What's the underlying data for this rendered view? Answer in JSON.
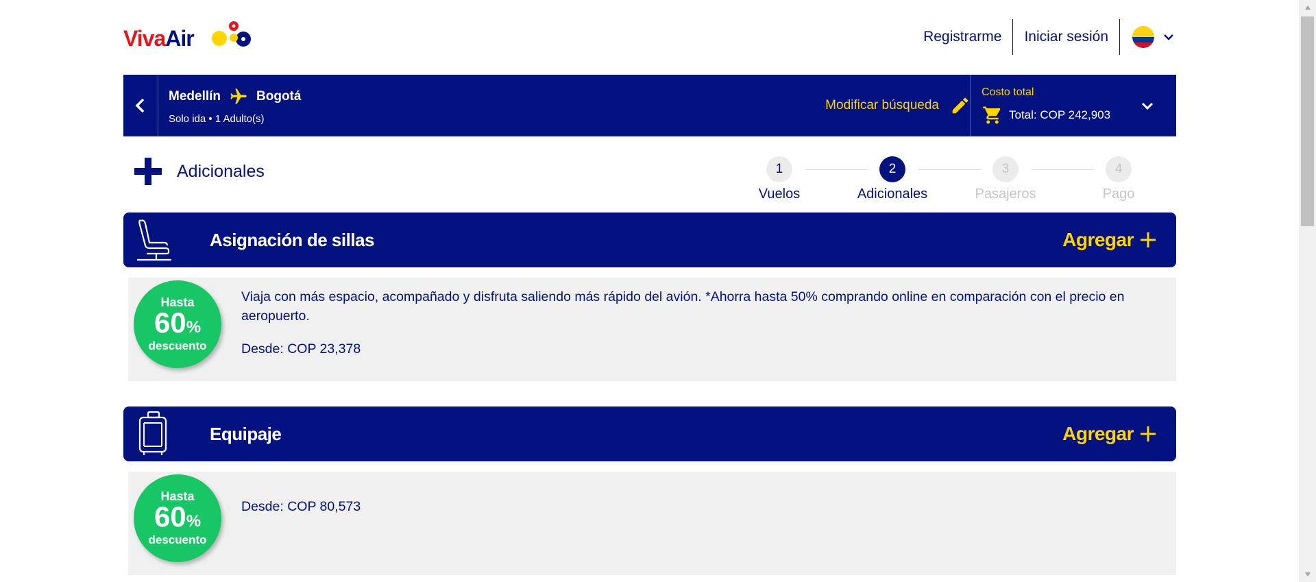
{
  "brand": {
    "viva": "Viva",
    "air": "Air",
    "red": "#e3151d",
    "blue": "#03127e",
    "yellow": "#ffd400"
  },
  "nav": {
    "register": "Registrarme",
    "login": "Iniciar sesión",
    "flag_colors": [
      "#fcd116",
      "#003893",
      "#ce1126"
    ]
  },
  "search": {
    "origin": "Medellín",
    "destination": "Bogotá",
    "trip_info": "Solo ida • 1 Adulto(s)",
    "modify": "Modificar búsqueda",
    "total_label": "Costo total",
    "total_value": "Total: COP 242,903"
  },
  "page": {
    "title": "Adicionales"
  },
  "stepper": [
    {
      "num": "1",
      "label": "Vuelos",
      "state": "done"
    },
    {
      "num": "2",
      "label": "Adicionales",
      "state": "active"
    },
    {
      "num": "3",
      "label": "Pasajeros",
      "state": "future"
    },
    {
      "num": "4",
      "label": "Pago",
      "state": "future"
    }
  ],
  "addons": [
    {
      "title": "Asignación de sillas",
      "add": "Agregar",
      "badge": {
        "line1": "Hasta",
        "line2": "60",
        "pct": "%",
        "line3": "descuento"
      },
      "description": "Viaja con más espacio, acompañado y disfruta saliendo más rápido del avión. *Ahorra hasta 50% comprando online en comparación con el precio en aeropuerto.",
      "price": "Desde: COP 23,378"
    },
    {
      "title": "Equipaje",
      "add": "Agregar",
      "badge": {
        "line1": "Hasta",
        "line2": "60",
        "pct": "%",
        "line3": "descuento"
      },
      "description": "",
      "price": "Desde: COP 80,573"
    }
  ]
}
